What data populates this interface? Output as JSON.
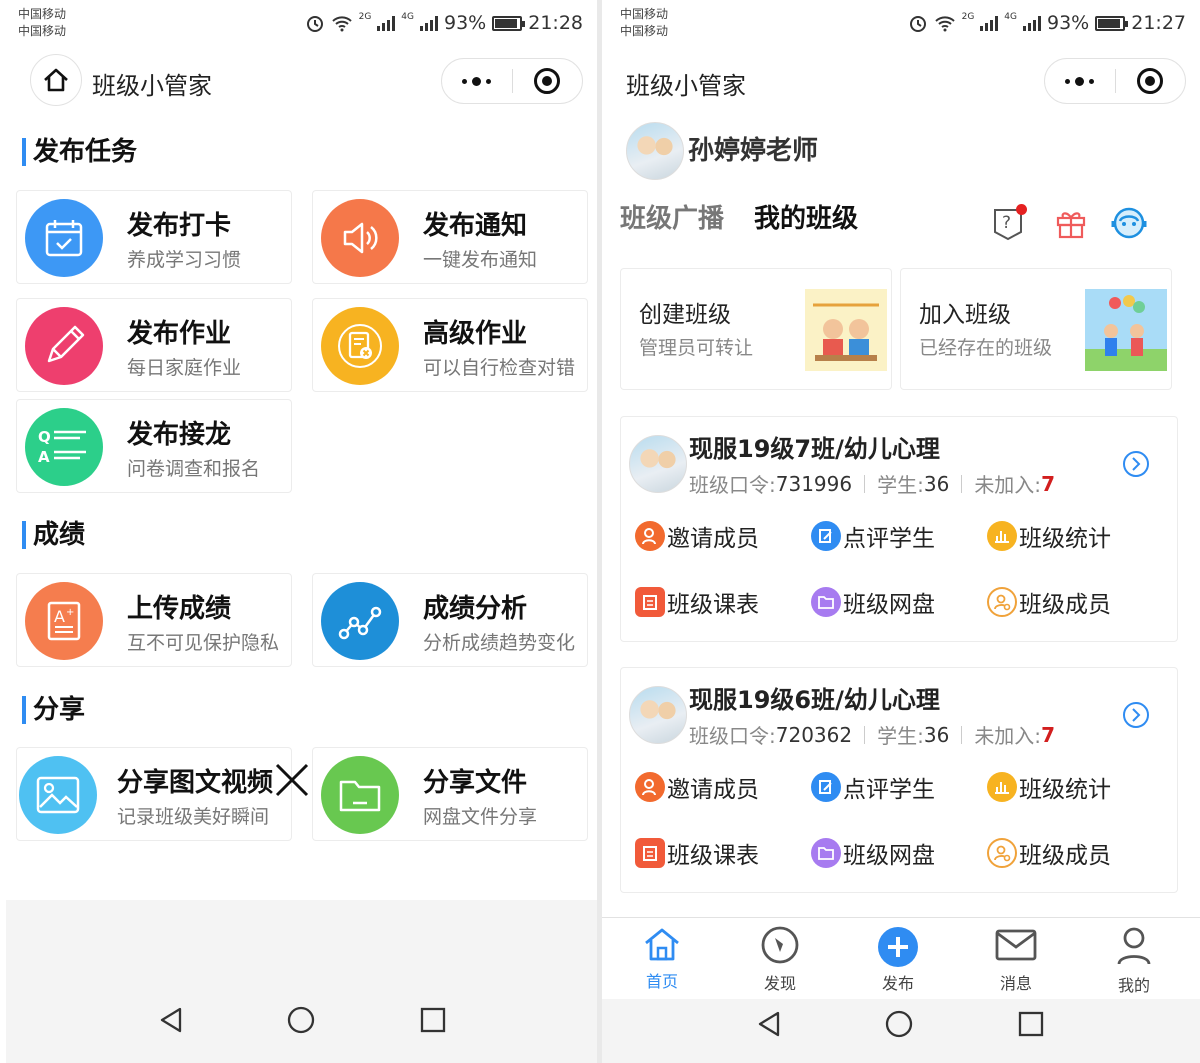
{
  "left": {
    "status": {
      "carrier1": "中国移动",
      "carrier2": "中国移动",
      "net1": "2G",
      "net2": "4G",
      "battery": "93%",
      "time": "21:28"
    },
    "nav": {
      "title": "班级小管家"
    },
    "sections": {
      "publish": "发布任务",
      "grades": "成绩",
      "share": "分享"
    },
    "cards": {
      "checkin": {
        "title": "发布打卡",
        "subtitle": "养成学习习惯"
      },
      "notice": {
        "title": "发布通知",
        "subtitle": "一键发布通知"
      },
      "homework": {
        "title": "发布作业",
        "subtitle": "每日家庭作业"
      },
      "advanced": {
        "title": "高级作业",
        "subtitle": "可以自行检查对错"
      },
      "relay": {
        "title": "发布接龙",
        "subtitle": "问卷调查和报名"
      },
      "upload": {
        "title": "上传成绩",
        "subtitle": "互不可见保护隐私"
      },
      "analysis": {
        "title": "成绩分析",
        "subtitle": "分析成绩趋势变化"
      },
      "media": {
        "title": "分享图文视频",
        "subtitle": "记录班级美好瞬间"
      },
      "files": {
        "title": "分享文件",
        "subtitle": "网盘文件分享"
      }
    },
    "colors": {
      "accent": "#2f8cf2"
    }
  },
  "right": {
    "status": {
      "carrier1": "中国移动",
      "carrier2": "中国移动",
      "net1": "2G",
      "net2": "4G",
      "battery": "93%",
      "time": "21:27"
    },
    "nav": {
      "title": "班级小管家"
    },
    "teacher": "孙婷婷老师",
    "tabs": {
      "broadcast": "班级广播",
      "myclass": "我的班级"
    },
    "join_cards": {
      "create": {
        "title": "创建班级",
        "subtitle": "管理员可转让"
      },
      "join": {
        "title": "加入班级",
        "subtitle": "已经存在的班级"
      }
    },
    "classes": [
      {
        "name": "现服19级7班/幼儿心理",
        "code_label": "班级口令:",
        "code": "731996",
        "students_label": "学生:",
        "students": "36",
        "unjoined_label": "未加入:",
        "unjoined": "7"
      },
      {
        "name": "现服19级6班/幼儿心理",
        "code_label": "班级口令:",
        "code": "720362",
        "students_label": "学生:",
        "students": "36",
        "unjoined_label": "未加入:",
        "unjoined": "7"
      }
    ],
    "actions": {
      "invite": "邀请成员",
      "review": "点评学生",
      "stats": "班级统计",
      "schedule": "班级课表",
      "disk": "班级网盘",
      "members": "班级成员"
    },
    "tabbar": {
      "home": "首页",
      "discover": "发现",
      "publish": "发布",
      "messages": "消息",
      "mine": "我的"
    }
  }
}
